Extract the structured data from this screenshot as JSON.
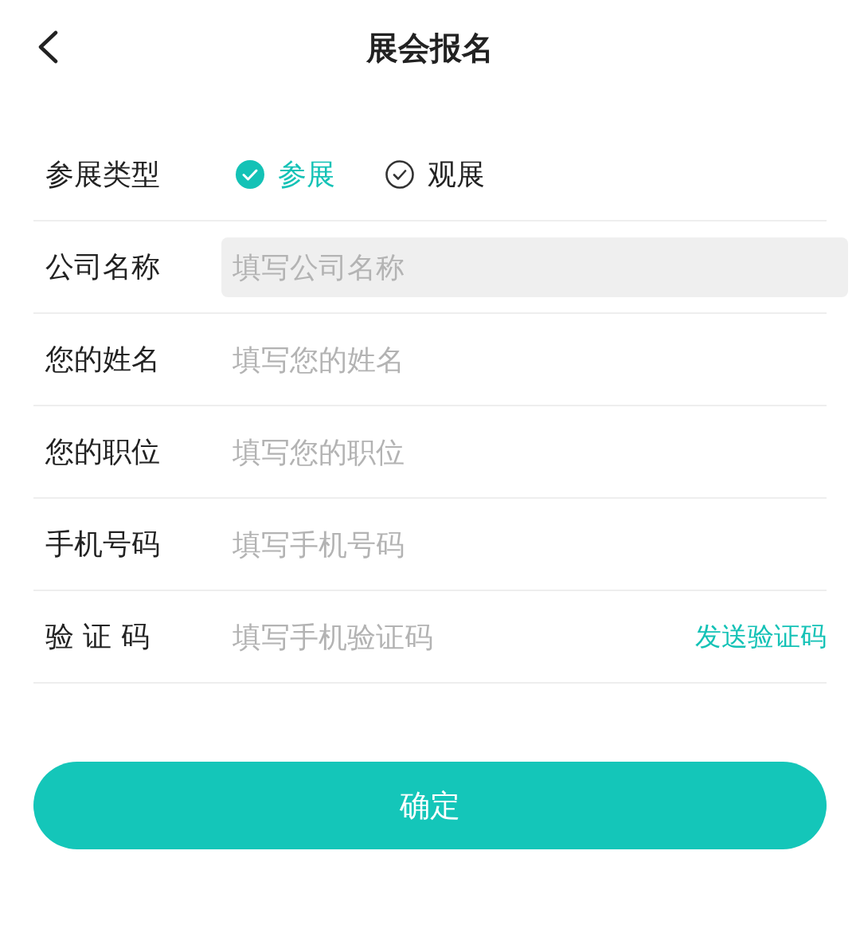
{
  "header": {
    "title": "展会报名"
  },
  "participation": {
    "label": "参展类型",
    "options": [
      {
        "label": "参展",
        "selected": true
      },
      {
        "label": "观展",
        "selected": false
      }
    ]
  },
  "fields": [
    {
      "label": "公司名称",
      "placeholder": "填写公司名称",
      "focused": true
    },
    {
      "label": "您的姓名",
      "placeholder": "填写您的姓名",
      "focused": false
    },
    {
      "label": "您的职位",
      "placeholder": "填写您的职位",
      "focused": false
    },
    {
      "label": "手机号码",
      "placeholder": "填写手机号码",
      "focused": false
    },
    {
      "label": "验 证 码",
      "placeholder": "填写手机验证码",
      "focused": false,
      "action": "发送验证码"
    }
  ],
  "submit_button": "确定"
}
